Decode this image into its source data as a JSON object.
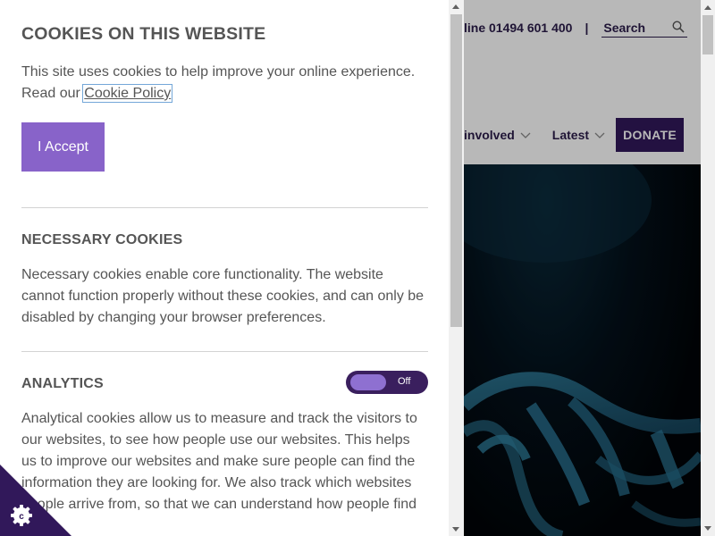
{
  "site": {
    "helpline": "line 01494 601 400",
    "separator": "|",
    "search_placeholder": "Search",
    "nav": [
      {
        "label": "involved"
      },
      {
        "label": "Latest"
      }
    ],
    "donate_label": "DONATE"
  },
  "cookie_panel": {
    "title": "COOKIES ON THIS WEBSITE",
    "intro_text": "This site uses cookies to help improve your online experience. Read our ",
    "policy_link": "Cookie Policy",
    "accept_label": "I Accept",
    "necessary": {
      "heading": "NECESSARY COOKIES",
      "text": "Necessary cookies enable core functionality. The website cannot function properly without these cookies, and can only be disabled by changing your browser preferences."
    },
    "analytics": {
      "heading": "ANALYTICS",
      "toggle_state": "Off",
      "text": "Analytical cookies allow us to measure and track the visitors to our websites, to see how people use our websites. This helps us to improve our websites and make sure people can find the information they are looking for. We also track which websites people arrive from, so that we can understand how people find"
    }
  },
  "colors": {
    "accent_purple": "#8863c9",
    "dark_purple": "#31185a",
    "toggle_track": "#3a1f5e",
    "text_grey": "#555555"
  },
  "icons": {
    "search": "search-icon",
    "chevron": "chevron-down-icon",
    "cookie_badge": "cookie-settings-icon"
  }
}
